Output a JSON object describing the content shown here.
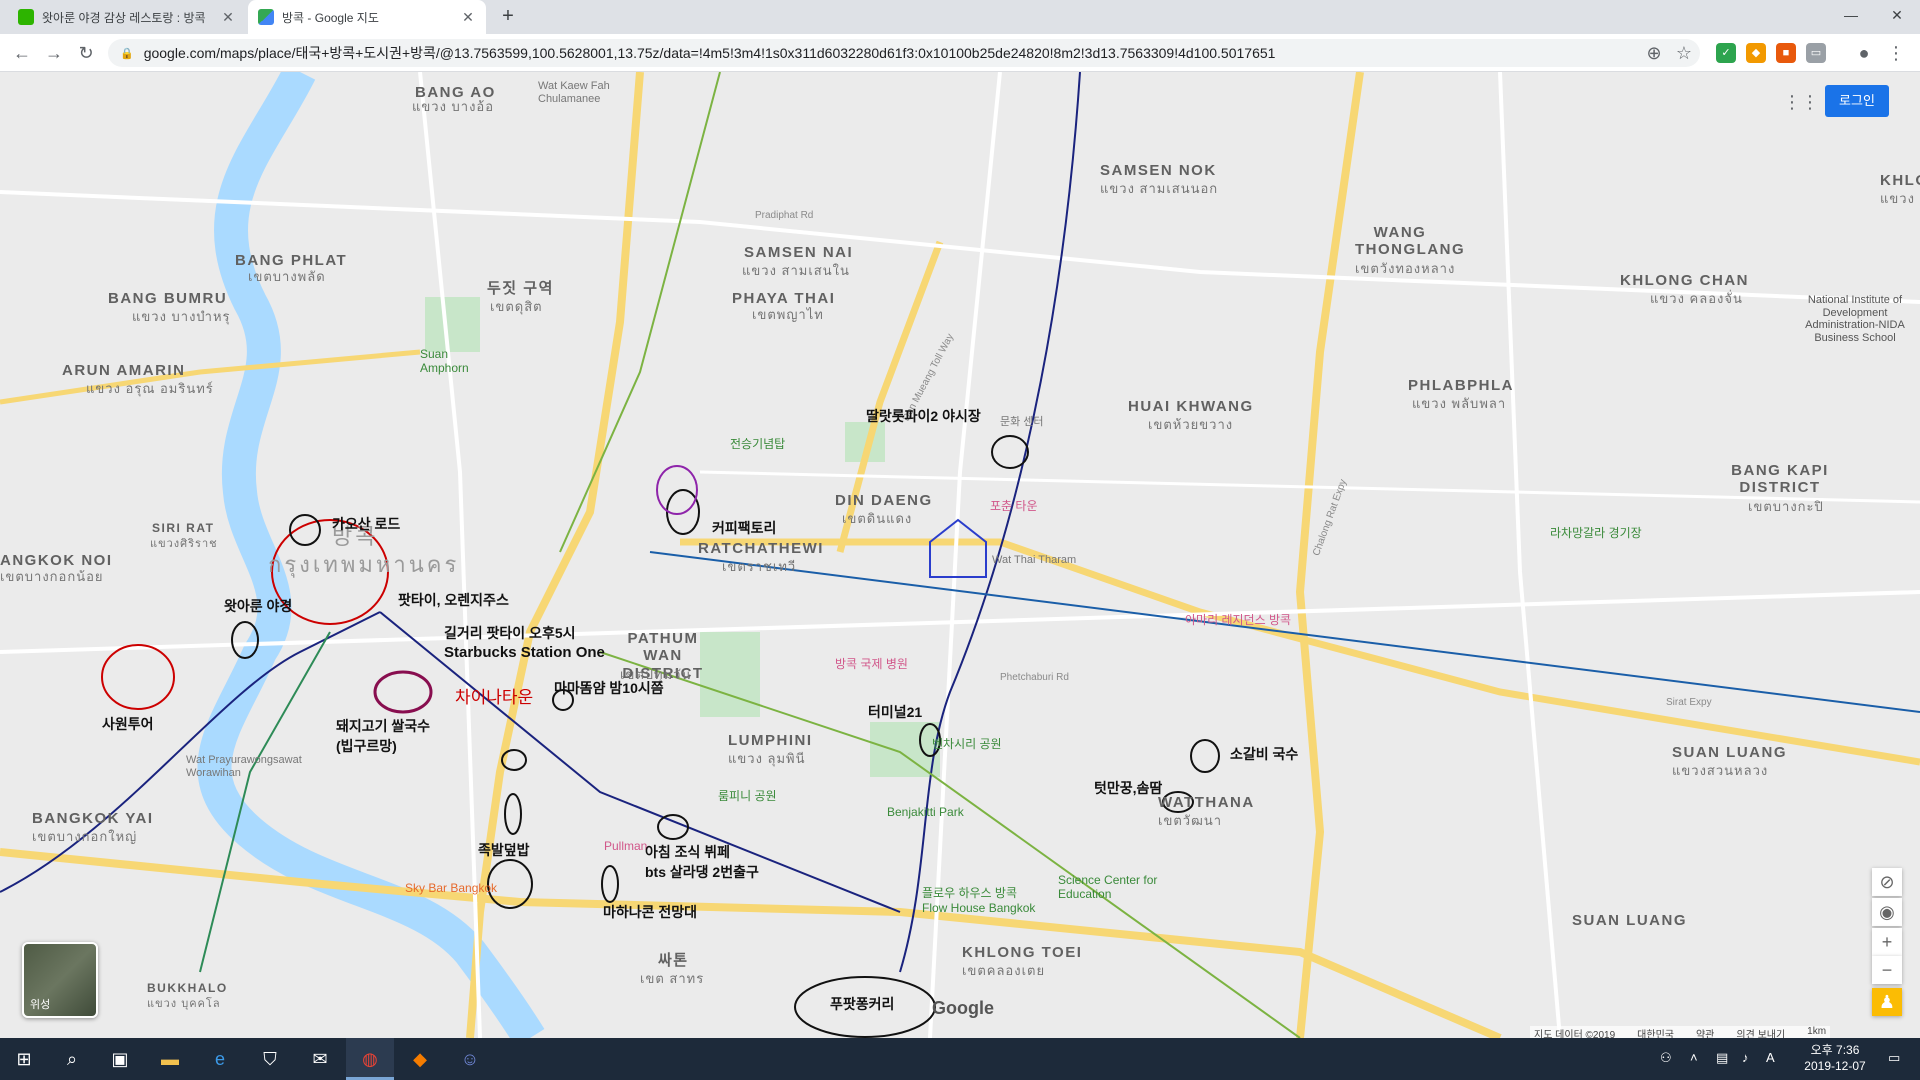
{
  "browser": {
    "tabs": [
      {
        "title": "왓아룬 야경 감상 레스토랑 : 방콕",
        "favicon_color": "#2db400"
      },
      {
        "title": "방콕 - Google 지도",
        "favicon_color": "#34a853"
      }
    ],
    "new_tab": "+",
    "url": "google.com/maps/place/태국+방콕+도시권+방콕/@13.7563599,100.5628001,13.75z/data=!4m5!3m4!1s0x311d6032280d61f3:0x10100b25de24820!8m2!3d13.7563309!4d100.5017651"
  },
  "map": {
    "login_label": "로그인",
    "satellite_label": "위성",
    "google_logo": "Google",
    "attribution": [
      "지도 데이터 ©2019",
      "대한민국",
      "약관",
      "의견 보내기",
      "1km"
    ],
    "districts": [
      {
        "name": "BANG AO",
        "sub": "แขวง บางอ้อ"
      },
      {
        "name": "BANG PHLAT",
        "sub": "เขตบางพลัด"
      },
      {
        "name": "BANG BUMRU",
        "sub": "แขวง บางบำหรุ"
      },
      {
        "name": "ARUN AMARIN",
        "sub": "แขวง อรุณ อมรินทร์"
      },
      {
        "name": "SIRI RAT",
        "sub": "แขวงศิริราช"
      },
      {
        "name": "ANGKOK NOI",
        "sub": "เขตบางกอกน้อย"
      },
      {
        "name": "BANGKOK YAI",
        "sub": "เขตบางกอกใหญ่"
      },
      {
        "name": "BUKKHALO",
        "sub": "แขวง บุคคโล"
      },
      {
        "name": "SAMSEN NOK",
        "sub": "แขวง สามเสนนอก"
      },
      {
        "name": "SAMSEN NAI",
        "sub": "แขวง สามเสนใน"
      },
      {
        "name": "PHAYA THAI",
        "sub": "เขตพญาไท"
      },
      {
        "name": "WANG THONGLANG",
        "sub": "เขตวังทองหลาง"
      },
      {
        "name": "KHLONG CHAN",
        "sub": "แขวง คลองจั่น"
      },
      {
        "name": "KHLONG",
        "sub": "แขวง คลองจ"
      },
      {
        "name": "HUAI KHWANG",
        "sub": "เขตห้วยขวาง"
      },
      {
        "name": "PHLABPHLA",
        "sub": "แขวง พลับพลา"
      },
      {
        "name": "BANG KAPI DISTRICT",
        "sub": "เขตบางกะปิ"
      },
      {
        "name": "DIN DAENG",
        "sub": "เขตดินแดง"
      },
      {
        "name": "RATCHATHEWI",
        "sub": "เขตราชเทวี"
      },
      {
        "name": "PATHUM WAN DISTRICT",
        "sub": "เขตปทุมวัน"
      },
      {
        "name": "LUMPHINI",
        "sub": "แขวง ลุมพินี"
      },
      {
        "name": "WATTHANA",
        "sub": "เขตวัฒนา"
      },
      {
        "name": "SUAN LUANG",
        "sub": "แขวงสวนหลวง"
      },
      {
        "name": "KHLONG TOEI",
        "sub": "เขตคลองเตย"
      },
      {
        "name": "싸톤",
        "sub": "เขต สาทร"
      },
      {
        "name": "두짓 구역",
        "sub": "เขตดุสิต"
      },
      {
        "name": "방콕",
        "sub": "กรุงเทพมหานคร"
      }
    ],
    "pois": [
      {
        "name": "Wat Kaew Fah Chulamanee"
      },
      {
        "name": "Suan Amphorn"
      },
      {
        "name": "전승기념탑"
      },
      {
        "name": "문화 센터"
      },
      {
        "name": "포춘 타운"
      },
      {
        "name": "Wat Thai Tharam"
      },
      {
        "name": "라차망갈라 경기장"
      },
      {
        "name": "아마리 레지던스 방콕"
      },
      {
        "name": "방콕 국제 병원"
      },
      {
        "name": "벤차시리 공원"
      },
      {
        "name": "Benjakitti Park"
      },
      {
        "name": "룸피니 공원"
      },
      {
        "name": "Pullman"
      },
      {
        "name": "Science Center for Education"
      },
      {
        "name": "플로우 하우스 방콕"
      },
      {
        "name": "Flow House Bangkok"
      },
      {
        "name": "Wat Prayurawongsawat Worawihan"
      },
      {
        "name": "Sky Bar Bangkok"
      },
      {
        "name": "Pradiphat Rd"
      },
      {
        "name": "Phetchaburi Rd"
      },
      {
        "name": "Sirat Expy"
      },
      {
        "name": "Don Mueang Toll Way"
      },
      {
        "name": "Chalong Rat Expy"
      },
      {
        "name": "National Institute of Development Administration-NIDA Business School"
      }
    ],
    "annotations": [
      "딸랏롯파이2 야시장",
      "카오산 로드",
      "팟타이, 오렌지주스",
      "커피팩토리",
      "왓아룬 야경",
      "길거리 팟타이 오후5시",
      "Starbucks Station One",
      "차이나타운",
      "마마똠얌 밤10시쯤",
      "터미널21",
      "사원투어",
      "돼지고기 쌀국수",
      "(빕구르망)",
      "소갈비 국수",
      "텃만꿍,솜땀",
      "족발덮밥",
      "아침 조식 뷔페",
      "bts 살라댕 2번출구",
      "마하나콘 전망대",
      "푸팟퐁커리"
    ]
  },
  "taskbar": {
    "time": "오후 7:36",
    "date": "2019-12-07",
    "ime": "A"
  }
}
